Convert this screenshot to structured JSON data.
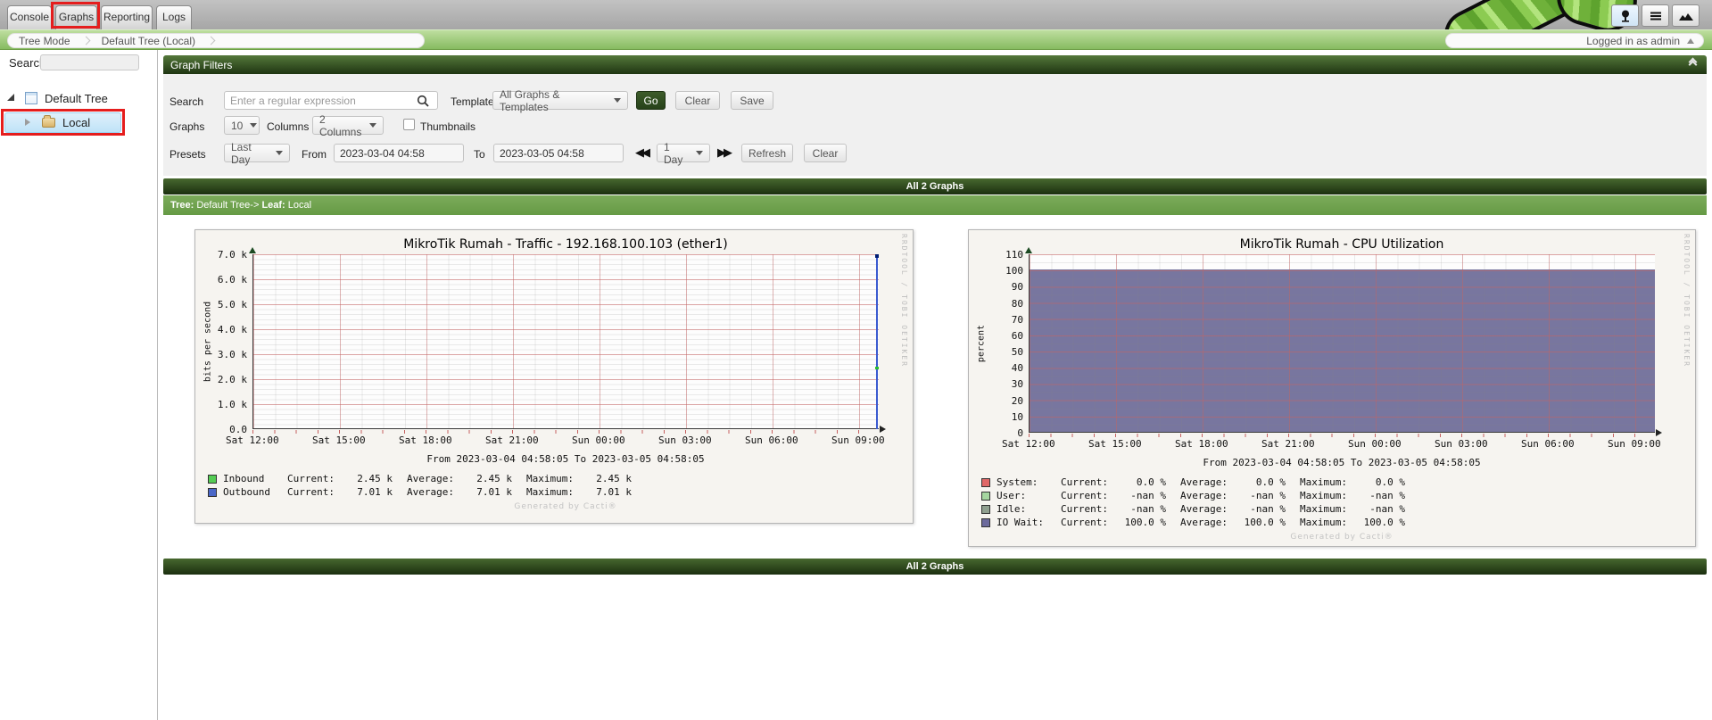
{
  "tabs": {
    "items": [
      "Console",
      "Graphs",
      "Reporting",
      "Logs"
    ],
    "selected": "Graphs"
  },
  "view_modes": {
    "icons": [
      "tree-view",
      "list-view",
      "preview-view"
    ],
    "active": "tree-view"
  },
  "breadcrumb": {
    "items": [
      "Tree Mode",
      "Default Tree (Local)"
    ]
  },
  "user": {
    "label": "Logged in as admin"
  },
  "sidebar": {
    "search_label": "Search",
    "tree": {
      "root_label": "Default Tree",
      "child_label": "Local",
      "selected": "Local"
    }
  },
  "filters": {
    "title": "Graph Filters",
    "search_label": "Search",
    "search_placeholder": "Enter a regular expression",
    "template_label": "Template",
    "template_value": "All Graphs & Templates",
    "go_label": "Go",
    "clear_label": "Clear",
    "save_label": "Save",
    "graphs_label": "Graphs",
    "graphs_value": "10",
    "columns_label": "Columns",
    "columns_value": "2 Columns",
    "thumbnails_label": "Thumbnails",
    "thumbnails_checked": false,
    "presets_label": "Presets",
    "presets_value": "Last Day",
    "from_label": "From",
    "from_value": "2023-03-04 04:58",
    "to_label": "To",
    "to_value": "2023-03-05 04:58",
    "interval_value": "1 Day",
    "refresh_label": "Refresh",
    "clear2_label": "Clear"
  },
  "bars": {
    "top_label": "All 2 Graphs",
    "bottom_label": "All 2 Graphs",
    "tree_label": "Tree:",
    "tree_value": "Default Tree->",
    "leaf_label": "Leaf:",
    "leaf_value": "Local"
  },
  "icons": {
    "magnifier": "search",
    "caret": "dropdown-caret",
    "double_back": "◀◀",
    "double_forward": "▶▶",
    "collapse": "double-chevron-up",
    "tree_view": "tree",
    "list_view": "hamburger",
    "preview_view": "mountains",
    "folder": "folder",
    "login_caret": "triangle-up"
  },
  "accent_colors": {
    "header_green": "#2c4a1c",
    "bar_green": "#6da14c",
    "highlight_red": "#e51d1d"
  },
  "chart_data": [
    {
      "type": "line",
      "title": "MikroTik Rumah - Traffic - 192.168.100.103 (ether1)",
      "ylabel": "bits per second",
      "ylim": [
        0,
        7000
      ],
      "ytick_values": [
        7000,
        6000,
        5000,
        4000,
        3000,
        2000,
        1000,
        0
      ],
      "ytick_labels": [
        "7.0 k",
        "6.0 k",
        "5.0 k",
        "4.0 k",
        "3.0 k",
        "2.0 k",
        "1.0 k",
        "0.0"
      ],
      "xticks": [
        "Sat 12:00",
        "Sat 15:00",
        "Sat 18:00",
        "Sat 21:00",
        "Sun 00:00",
        "Sun 03:00",
        "Sun 06:00",
        "Sun 09:00"
      ],
      "x_range": "From 2023-03-04 04:58:05 To 2023-03-05 04:58:05",
      "grid": true,
      "legend_columns": [
        "Current:",
        "Average:",
        "Maximum:"
      ],
      "legend": [
        {
          "name": "Inbound",
          "color": "#54cc54",
          "current": "2.45 k",
          "average": "2.45 k",
          "maximum": "2.45 k"
        },
        {
          "name": "Outbound",
          "color": "#4a67c8",
          "current": "7.01 k",
          "average": "7.01 k",
          "maximum": "7.01 k"
        }
      ],
      "series_note": "no data across window except single spike at right edge",
      "spike": {
        "x_frac": 0.995,
        "outbound_bps": 7010,
        "inbound_bps": 2450,
        "line_color": "#3b5bd0",
        "cap_color": "#001d72",
        "inbound_color": "#2bbf2b"
      },
      "watermark": "Generated by Cacti®",
      "side_text": "RRDTOOL / TOBI OETIKER"
    },
    {
      "type": "area",
      "title": "MikroTik Rumah - CPU Utilization",
      "ylabel": "percent",
      "ylim": [
        0,
        110
      ],
      "ytick_values": [
        110,
        100,
        90,
        80,
        70,
        60,
        50,
        40,
        30,
        20,
        10,
        0
      ],
      "ytick_labels": [
        "110",
        "100",
        "90",
        "80",
        "70",
        "60",
        "50",
        "40",
        "30",
        "20",
        "10",
        "0"
      ],
      "xticks": [
        "Sat 12:00",
        "Sat 15:00",
        "Sat 18:00",
        "Sat 21:00",
        "Sun 00:00",
        "Sun 03:00",
        "Sun 06:00",
        "Sun 09:00"
      ],
      "x_range": "From 2023-03-04 04:58:05 To 2023-03-05 04:58:05",
      "grid": true,
      "area_fill": {
        "series": "IO Wait",
        "percent": 100,
        "color": "#78769f"
      },
      "legend_columns": [
        "Current:",
        "Average:",
        "Maximum:"
      ],
      "legend": [
        {
          "name": "System:",
          "color": "#e06767",
          "current": "0.0 %",
          "average": "0.0 %",
          "maximum": "0.0 %"
        },
        {
          "name": "User:",
          "color": "#a5d6a0",
          "current": "-nan %",
          "average": "-nan %",
          "maximum": "-nan %"
        },
        {
          "name": "Idle:",
          "color": "#90a090",
          "current": "-nan %",
          "average": "-nan %",
          "maximum": "-nan %"
        },
        {
          "name": "IO Wait:",
          "color": "#6c6a9c",
          "current": "100.0 %",
          "average": "100.0 %",
          "maximum": "100.0 %"
        }
      ],
      "watermark": "Generated by Cacti®",
      "side_text": "RRDTOOL / TOBI OETIKER"
    }
  ]
}
